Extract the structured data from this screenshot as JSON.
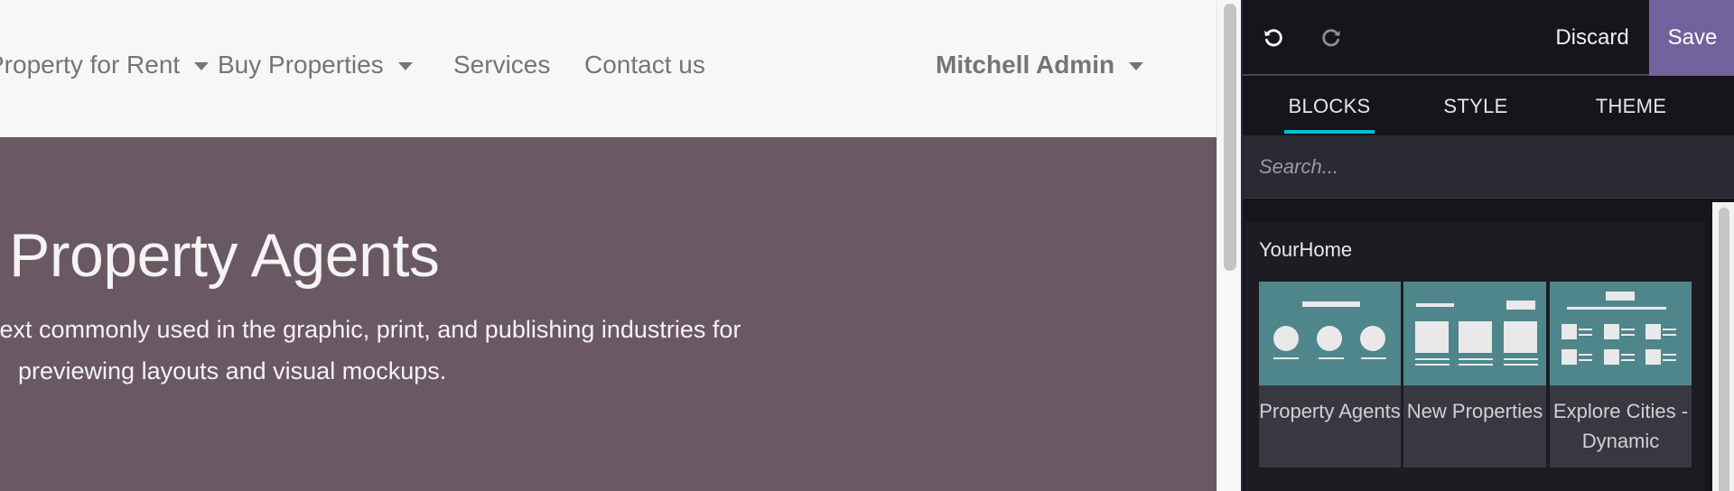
{
  "website": {
    "nav": {
      "items": [
        {
          "label": "Property for Rent",
          "has_dropdown": true
        },
        {
          "label": "Buy Properties",
          "has_dropdown": true
        },
        {
          "label": "Services",
          "has_dropdown": false
        },
        {
          "label": "Contact us",
          "has_dropdown": false
        }
      ],
      "user": {
        "label": "Mitchell Admin",
        "has_dropdown": true
      }
    },
    "hero": {
      "title": "Property Agents",
      "line1": "text commonly used in the graphic, print, and publishing industries for",
      "line2": "previewing layouts and visual mockups.",
      "background_color": "#6a5863"
    }
  },
  "editor": {
    "toolbar": {
      "undo_icon": "undo-icon",
      "redo_icon": "redo-icon",
      "discard_label": "Discard",
      "save_label": "Save",
      "save_color": "#71639e"
    },
    "tabs": [
      {
        "label": "BLOCKS",
        "active": true
      },
      {
        "label": "STYLE",
        "active": false
      },
      {
        "label": "THEME",
        "active": false
      }
    ],
    "tab_indicator_color": "#00bcd4",
    "search": {
      "placeholder": "Search...",
      "value": ""
    },
    "section": {
      "title": "YourHome",
      "snippets": [
        {
          "label": "Property Agents",
          "thumbnail": "three-circles-layout"
        },
        {
          "label": "New Properties",
          "thumbnail": "three-cards-layout"
        },
        {
          "label": "Explore Cities - Dynamic",
          "thumbnail": "grid-list-layout"
        }
      ],
      "thumbnail_color": "#4f868c"
    }
  }
}
